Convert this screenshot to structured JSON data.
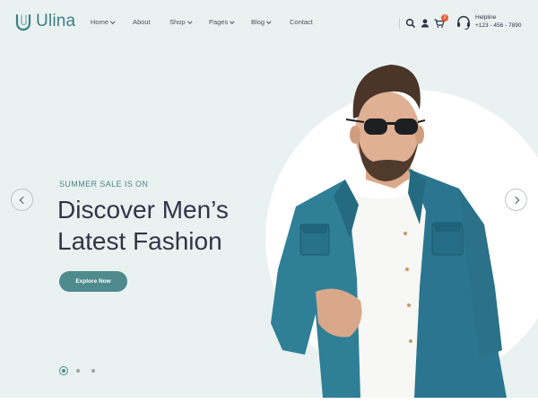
{
  "brand": {
    "name": "Ulina"
  },
  "nav": {
    "items": [
      {
        "label": "Home",
        "has_dropdown": true
      },
      {
        "label": "About",
        "has_dropdown": false
      },
      {
        "label": "Shop",
        "has_dropdown": true
      },
      {
        "label": "Pages",
        "has_dropdown": true
      },
      {
        "label": "Blog",
        "has_dropdown": true
      },
      {
        "label": "Contact",
        "has_dropdown": false
      }
    ]
  },
  "header_icons": [
    "search-icon",
    "user-icon",
    "cart-icon"
  ],
  "cart": {
    "count": "0"
  },
  "helpline": {
    "label": "Helpline",
    "phone": "+123 - 456 - 7890"
  },
  "hero": {
    "eyebrow": "SUMMER SALE IS ON",
    "headline_line1": "Discover Men’s",
    "headline_line2": "Latest Fashion",
    "cta_label": "Explore Now"
  },
  "slider": {
    "slide_count": 3,
    "active_index": 0
  },
  "colors": {
    "accent": "#4f8a8f",
    "hero_background": "#eaf1f1",
    "badge": "#e5582f",
    "heading": "#2d3748",
    "jacket": "#2f7f96"
  }
}
